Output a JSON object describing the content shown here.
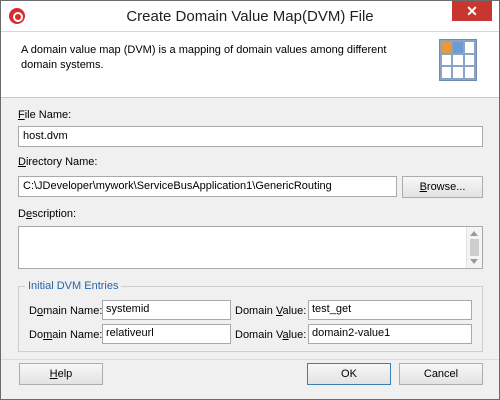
{
  "window": {
    "title": "Create Domain Value Map(DVM) File",
    "close_label": "✕"
  },
  "banner": {
    "description": "A domain value map (DVM) is a mapping of domain values among different domain systems.",
    "icon": "dvm-grid-icon"
  },
  "file_name": {
    "label_mnemonic": "F",
    "label_rest": "ile Name:",
    "value": "host.dvm"
  },
  "directory_name": {
    "label_mnemonic": "D",
    "label_rest": "irectory Name:",
    "value": "C:\\JDeveloper\\mywork\\ServiceBusApplication1\\GenericRouting",
    "browse_mnemonic": "B",
    "browse_rest": "rowse..."
  },
  "description": {
    "label_pre": "D",
    "label_mnemonic": "e",
    "label_rest": "scription:",
    "value": ""
  },
  "entries": {
    "title": "Initial DVM Entries",
    "rows": [
      {
        "domain_name_label_pre": "D",
        "domain_name_label_mnemonic": "o",
        "domain_name_label_rest": "main Name:",
        "domain_name": "systemid",
        "domain_value_label_pre": "Domain ",
        "domain_value_label_mnemonic": "V",
        "domain_value_label_rest": "alue:",
        "domain_value": "test_get"
      },
      {
        "domain_name_label_pre": "Do",
        "domain_name_label_mnemonic": "m",
        "domain_name_label_rest": "ain Name:",
        "domain_name": "relativeurl",
        "domain_value_label_pre": "Domain V",
        "domain_value_label_mnemonic": "a",
        "domain_value_label_rest": "lue:",
        "domain_value": "domain2-value1"
      }
    ]
  },
  "buttons": {
    "help_mnemonic": "H",
    "help_rest": "elp",
    "ok": "OK",
    "cancel": "Cancel"
  },
  "colors": {
    "close_button": "#c7372f",
    "group_title": "#2a62a8",
    "default_button_border": "#3c7fb1"
  }
}
